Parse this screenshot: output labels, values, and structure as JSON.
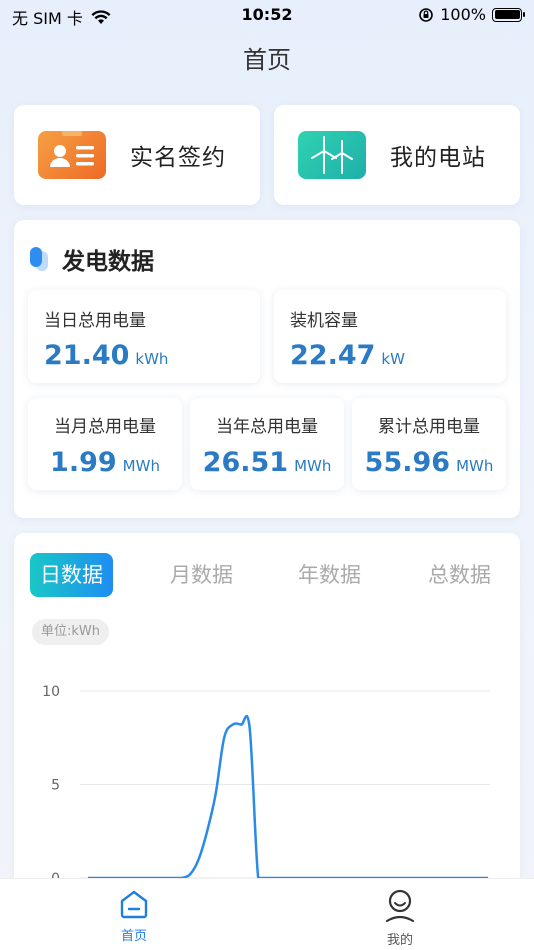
{
  "status": {
    "carrier": "无 SIM 卡",
    "time": "10:52",
    "battery": "100%",
    "battery_level": 1.0
  },
  "header": {
    "title": "首页"
  },
  "quick_actions": [
    {
      "label": "实名签约",
      "icon": "id-card-icon",
      "color": "#f07a2a"
    },
    {
      "label": "我的电站",
      "icon": "wind-turbine-icon",
      "color": "#22c3a5"
    }
  ],
  "generation": {
    "title": "发电数据",
    "stats": [
      {
        "label": "当日总用电量",
        "value": "21.40",
        "unit": "kWh"
      },
      {
        "label": "装机容量",
        "value": "22.47",
        "unit": "kW"
      },
      {
        "label": "当月总用电量",
        "value": "1.99",
        "unit": "MWh"
      },
      {
        "label": "当年总用电量",
        "value": "26.51",
        "unit": "MWh"
      },
      {
        "label": "累计总用电量",
        "value": "55.96",
        "unit": "MWh"
      }
    ]
  },
  "chart_tabs": [
    {
      "label": "日数据",
      "active": true
    },
    {
      "label": "月数据",
      "active": false
    },
    {
      "label": "年数据",
      "active": false
    },
    {
      "label": "总数据",
      "active": false
    }
  ],
  "unit_label": "单位:kWh",
  "chart_data": {
    "type": "line",
    "ylim": [
      0,
      10
    ],
    "yticks": [
      "0",
      "5",
      "10"
    ],
    "series": [
      {
        "values": [
          0,
          0,
          0,
          0,
          0,
          0,
          0,
          0,
          0,
          0,
          0,
          0,
          0.2,
          1.0,
          2.5,
          4.5,
          7.5,
          8.2,
          8.2,
          8.0,
          0,
          0,
          0,
          0,
          0,
          0,
          0,
          0,
          0,
          0,
          0,
          0,
          0,
          0,
          0,
          0,
          0,
          0,
          0,
          0,
          0,
          0,
          0,
          0,
          0,
          0,
          0,
          0
        ]
      }
    ],
    "color": "#2a8ae8",
    "grid": true
  },
  "tabbar": [
    {
      "label": "首页",
      "icon": "home-icon",
      "active": true
    },
    {
      "label": "我的",
      "icon": "user-icon",
      "active": false
    }
  ],
  "colors": {
    "accent": "#2a7bc3",
    "tab_active": "#1e7fe0"
  }
}
